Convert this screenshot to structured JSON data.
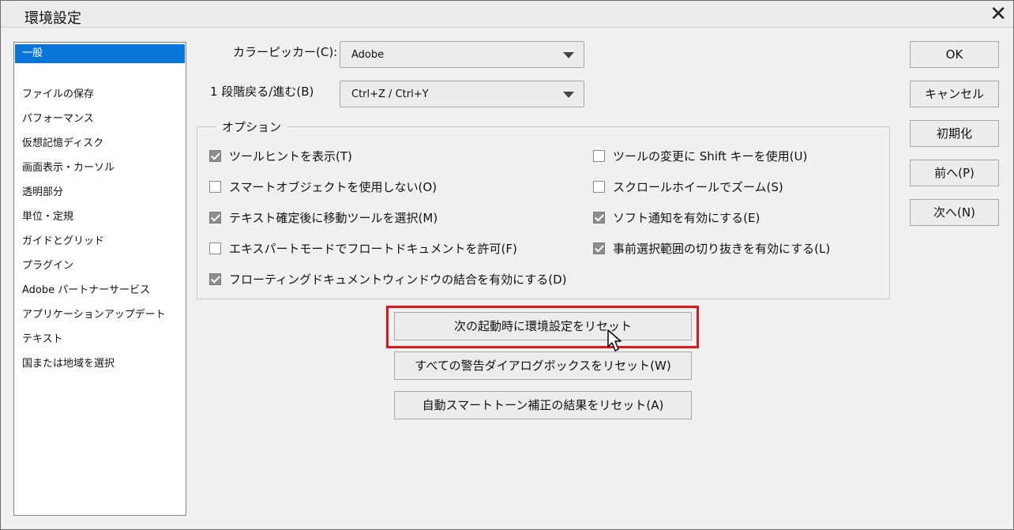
{
  "window": {
    "title": "環境設定",
    "close_glyph": "✕"
  },
  "sidebar": {
    "selected_index": 0,
    "items": [
      "一般",
      "ファイルの保存",
      "パフォーマンス",
      "仮想記憶ディスク",
      "画面表示・カーソル",
      "透明部分",
      "単位・定規",
      "ガイドとグリッド",
      "プラグイン",
      "Adobe パートナーサービス",
      "アプリケーションアップデート",
      "テキスト",
      "国または地域を選択"
    ]
  },
  "fields": {
    "color_picker": {
      "label": "カラーピッカー(C):",
      "value": "Adobe"
    },
    "undo": {
      "label": "1 段階戻る/進む(B)",
      "value": "Ctrl+Z / Ctrl+Y"
    }
  },
  "options": {
    "legend": "オプション",
    "items": [
      {
        "label": "ツールヒントを表示(T)",
        "checked": true
      },
      {
        "label": "スマートオブジェクトを使用しない(O)",
        "checked": false
      },
      {
        "label": "テキスト確定後に移動ツールを選択(M)",
        "checked": true
      },
      {
        "label": "エキスパートモードでフロートドキュメントを許可(F)",
        "checked": false
      },
      {
        "label": "フローティングドキュメントウィンドウの結合を有効にする(D)",
        "checked": true
      },
      {
        "label": "ツールの変更に Shift キーを使用(U)",
        "checked": false
      },
      {
        "label": "スクロールホイールでズーム(S)",
        "checked": false
      },
      {
        "label": "ソフト通知を有効にする(E)",
        "checked": true
      },
      {
        "label": "事前選択範囲の切り抜きを有効にする(L)",
        "checked": true
      }
    ]
  },
  "buttons": {
    "ok": "OK",
    "cancel": "キャンセル",
    "reset_defaults": "初期化",
    "prev": "前へ(P)",
    "next": "次へ(N)",
    "reset_prefs": "次の起動時に環境設定をリセット",
    "reset_warnings": "すべての警告ダイアログボックスをリセット(W)",
    "reset_smart_tone": "自動スマートトーン補正の結果をリセット(A)"
  },
  "colors": {
    "selection": "#0a76d9",
    "highlight_frame": "#e0171f"
  }
}
